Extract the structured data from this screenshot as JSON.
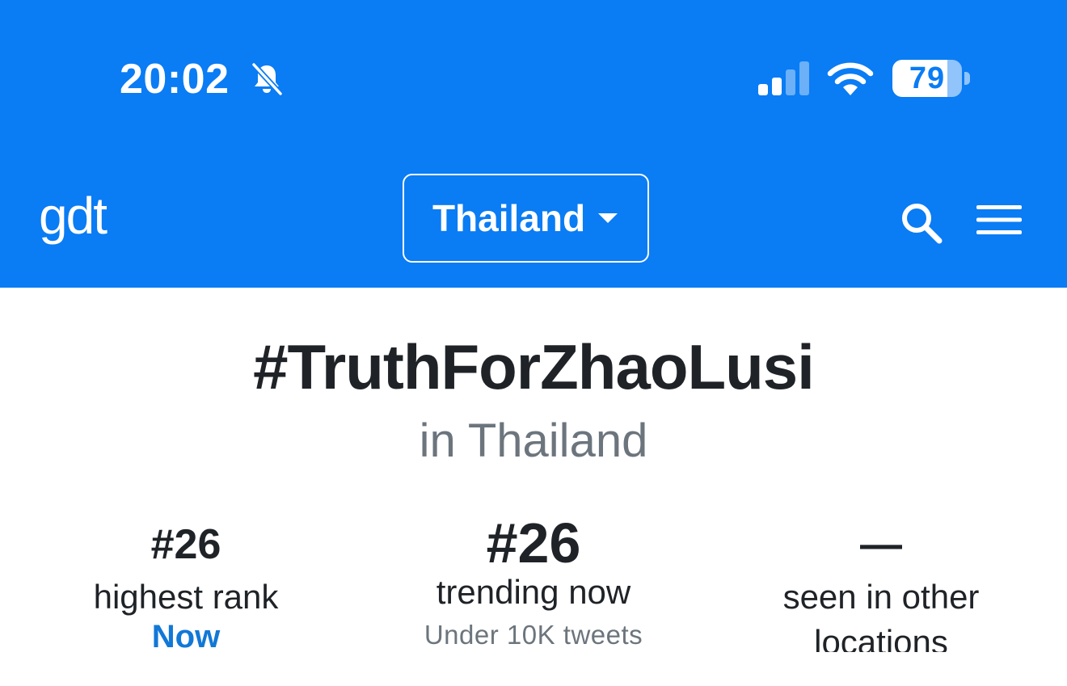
{
  "status_bar": {
    "time": "20:02",
    "battery": "79",
    "battery_level": 0.79,
    "icons": [
      "bell-slash-icon",
      "cellular-signal-icon",
      "wifi-icon",
      "battery-icon"
    ]
  },
  "nav": {
    "logo": "gdt",
    "location": "Thailand",
    "icons": [
      "search-icon",
      "menu-icon"
    ]
  },
  "trend": {
    "title": "#TruthForZhaoLusi",
    "subtitle": "in Thailand"
  },
  "stats": [
    {
      "value": "#26",
      "label": "highest rank",
      "note": "Now"
    },
    {
      "value": "#26",
      "label": "trending now",
      "note": "Under 10K tweets"
    },
    {
      "value": "—",
      "label": "seen in other",
      "label_cont": "locations"
    }
  ],
  "colors": {
    "header_blue": "#0a7cf4",
    "link_blue": "#1278d6",
    "text_dark": "#1f2327",
    "text_muted": "#6c757d"
  }
}
